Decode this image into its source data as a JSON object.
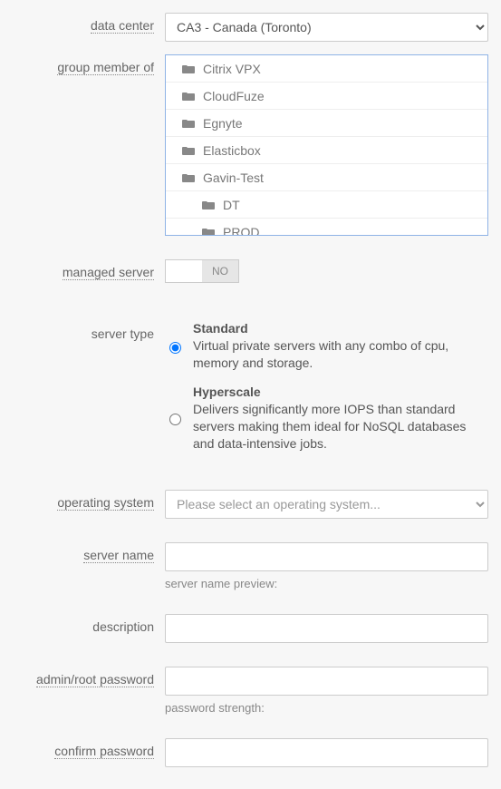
{
  "labels": {
    "data_center": "data center",
    "group_member_of": "group member of",
    "managed_server": "managed server",
    "server_type": "server type",
    "operating_system": "operating system",
    "server_name": "server name",
    "description": "description",
    "admin_password": "admin/root password",
    "confirm_password": "confirm password"
  },
  "data_center": {
    "selected": "CA3 - Canada (Toronto)"
  },
  "group_tree": {
    "items": [
      {
        "name": "Citrix VPX",
        "level": 0
      },
      {
        "name": "CloudFuze",
        "level": 0
      },
      {
        "name": "Egnyte",
        "level": 0
      },
      {
        "name": "Elasticbox",
        "level": 0
      },
      {
        "name": "Gavin-Test",
        "level": 0
      },
      {
        "name": "DT",
        "level": 1
      },
      {
        "name": "PROD",
        "level": 1
      }
    ]
  },
  "managed_server": {
    "state": "NO"
  },
  "server_type": {
    "options": [
      {
        "label": "Standard",
        "desc": "Virtual private servers with any combo of cpu, memory and storage.",
        "selected": true
      },
      {
        "label": "Hyperscale",
        "desc": "Delivers significantly more IOPS than standard servers making them ideal for NoSQL databases and data-intensive jobs.",
        "selected": false
      }
    ]
  },
  "operating_system": {
    "placeholder": "Please select an operating system..."
  },
  "server_name": {
    "value": "",
    "preview_label": "server name preview:"
  },
  "description": {
    "value": ""
  },
  "admin_password": {
    "value": "",
    "strength_label": "password strength:"
  },
  "confirm_password": {
    "value": ""
  }
}
